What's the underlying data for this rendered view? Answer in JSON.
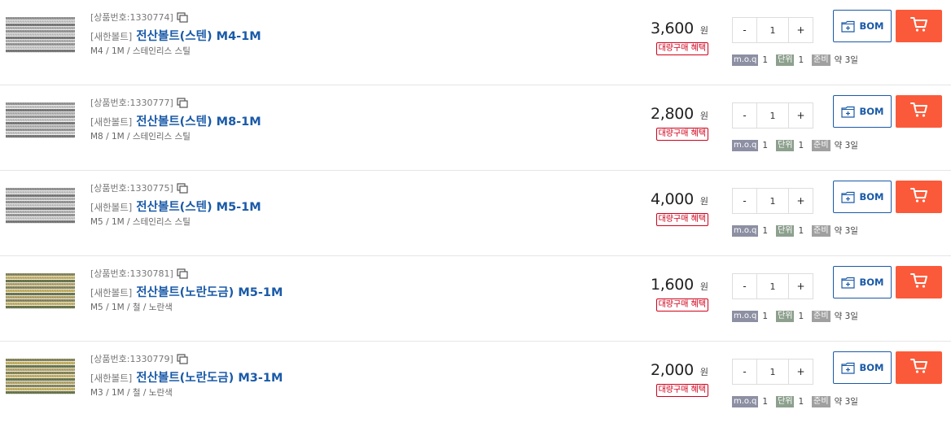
{
  "currency_label": "원",
  "bulk_label": "대량구매 혜택",
  "bom_label": "BOM",
  "minus_label": "-",
  "plus_label": "+",
  "meta_labels": {
    "moq": "m.o.q",
    "unit": "단위",
    "prep": "준비"
  },
  "colors": {
    "link": "#1a5aa8",
    "cart": "#fb5a3a",
    "bulk": "#d0021b"
  },
  "icons": {
    "copy": "copy-icon",
    "bom": "folder-plus-icon",
    "cart": "cart-icon"
  },
  "products": [
    {
      "code": "[상품번호:1330774]",
      "brand": "[새한볼트]",
      "name": "전산볼트(스텐) M4-1M",
      "spec": "M4 / 1M / 스테인리스 스틸",
      "price": "3,600",
      "qty": "1",
      "moq": "1",
      "unit": "1",
      "prep": "약 3일",
      "material": "steel"
    },
    {
      "code": "[상품번호:1330777]",
      "brand": "[새한볼트]",
      "name": "전산볼트(스텐) M8-1M",
      "spec": "M8 / 1M / 스테인리스 스틸",
      "price": "2,800",
      "qty": "1",
      "moq": "1",
      "unit": "1",
      "prep": "약 3일",
      "material": "steel"
    },
    {
      "code": "[상품번호:1330775]",
      "brand": "[새한볼트]",
      "name": "전산볼트(스텐) M5-1M",
      "spec": "M5 / 1M / 스테인리스 스틸",
      "price": "4,000",
      "qty": "1",
      "moq": "1",
      "unit": "1",
      "prep": "약 3일",
      "material": "steel"
    },
    {
      "code": "[상품번호:1330781]",
      "brand": "[새한볼트]",
      "name": "전산볼트(노란도금) M5-1M",
      "spec": "M5 / 1M / 철 / 노란색",
      "price": "1,600",
      "qty": "1",
      "moq": "1",
      "unit": "1",
      "prep": "약 3일",
      "material": "yellow"
    },
    {
      "code": "[상품번호:1330779]",
      "brand": "[새한볼트]",
      "name": "전산볼트(노란도금) M3-1M",
      "spec": "M3 / 1M / 철 / 노란색",
      "price": "2,000",
      "qty": "1",
      "moq": "1",
      "unit": "1",
      "prep": "약 3일",
      "material": "yellow"
    }
  ]
}
